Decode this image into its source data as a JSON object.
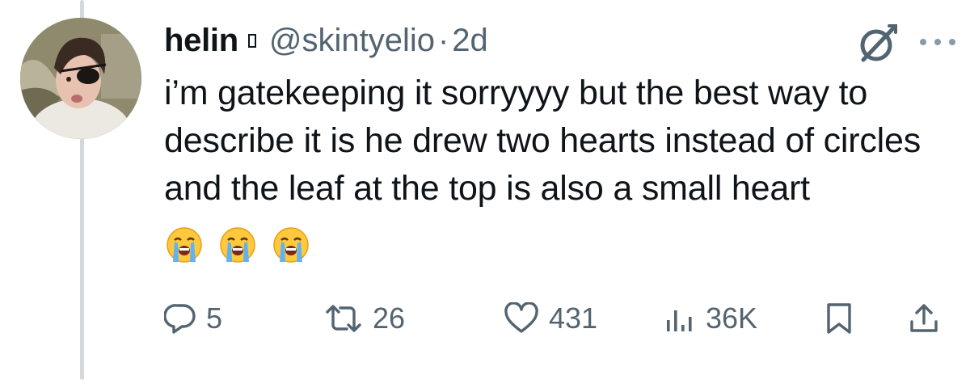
{
  "tweet": {
    "display_name": "helin",
    "handle": "@skintyelio",
    "separator": "·",
    "time": "2d",
    "text": "i’m gatekeeping it sorryyyy but the best way to describe it is he drew two hearts instead of circles and the leaf at the top is also a small heart",
    "emojis": [
      "loudly-crying-face",
      "loudly-crying-face",
      "loudly-crying-face"
    ]
  },
  "actions": {
    "replies": "5",
    "retweets": "26",
    "likes": "431",
    "views": "36K"
  },
  "icons": {
    "reply": "reply-icon",
    "retweet": "retweet-icon",
    "like": "heart-icon",
    "views": "views-icon",
    "bookmark": "bookmark-icon",
    "share": "share-icon",
    "grok": "grok-icon",
    "more": "more-icon"
  },
  "colors": {
    "text_primary": "#0f1419",
    "text_secondary": "#536471",
    "icon_gray": "#536471",
    "thread_line": "#d4d8db"
  }
}
